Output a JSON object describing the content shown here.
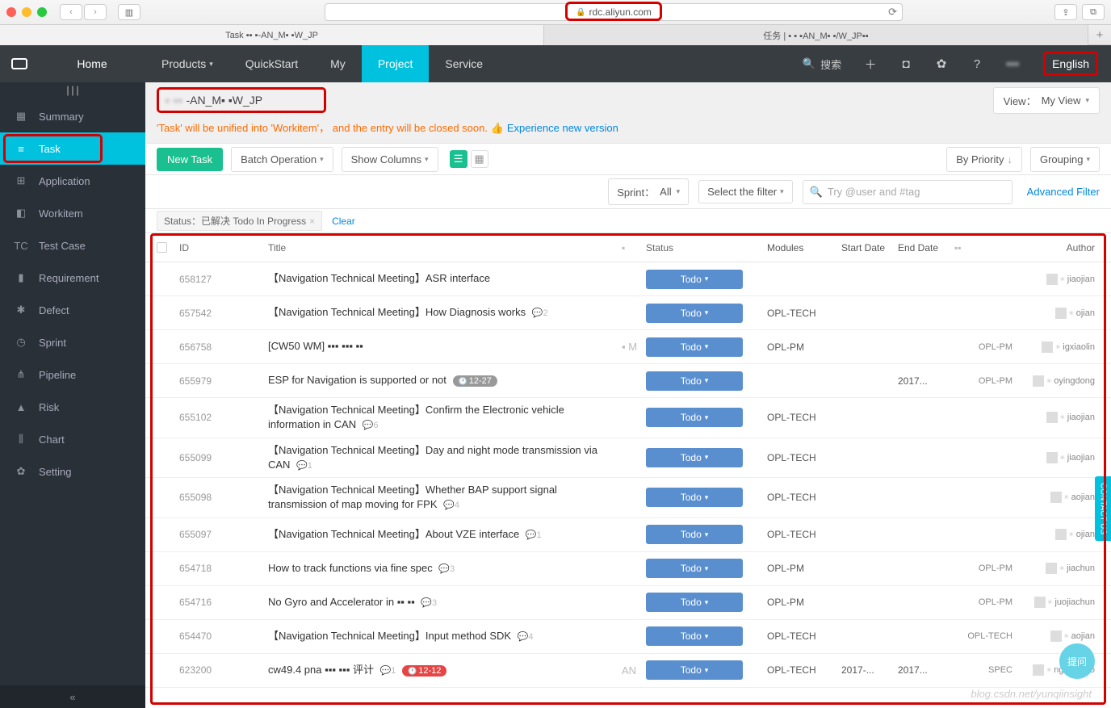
{
  "browser": {
    "url_host": "rdc.aliyun.com",
    "tabs": [
      "Task ▪▪ ▪-AN_M▪ ▪W_JP",
      "任务 | ▪ ▪ ▪AN_M▪ ▪/W_JP▪▪"
    ]
  },
  "topnav": {
    "home": "Home",
    "products": "Products",
    "quickstart": "QuickStart",
    "my": "My",
    "project": "Project",
    "service": "Service",
    "search_label": "搜索",
    "language": "English"
  },
  "sidebar": {
    "items": [
      {
        "icon": "▦",
        "label": "Summary"
      },
      {
        "icon": "≡",
        "label": "Task"
      },
      {
        "icon": "⊞",
        "label": "Application"
      },
      {
        "icon": "◧",
        "label": "Workitem"
      },
      {
        "icon": "TC",
        "label": "Test Case"
      },
      {
        "icon": "▮",
        "label": "Requirement"
      },
      {
        "icon": "✱",
        "label": "Defect"
      },
      {
        "icon": "◷",
        "label": "Sprint"
      },
      {
        "icon": "⋔",
        "label": "Pipeline"
      },
      {
        "icon": "▲",
        "label": "Risk"
      },
      {
        "icon": "⫼",
        "label": "Chart"
      },
      {
        "icon": "✿",
        "label": "Setting"
      }
    ]
  },
  "project": {
    "name_visible": "-AN_M▪ ▪W_JP",
    "view_label": "View：",
    "view_value": "My View"
  },
  "notice": {
    "warn": "'Task' will be unified into 'Workitem'， and the entry will be closed soon.",
    "link": "Experience new version"
  },
  "toolbar": {
    "new_task": "New Task",
    "batch_op": "Batch Operation",
    "show_cols": "Show Columns",
    "by_priority": "By Priority",
    "grouping": "Grouping"
  },
  "filter": {
    "sprint_label": "Sprint：",
    "sprint_value": "All",
    "select_filter": "Select the filter",
    "search_placeholder": "Try @user and #tag",
    "advanced": "Advanced Filter"
  },
  "status_chip": {
    "text": "Status：已解决  Todo  In Progress",
    "clear": "Clear"
  },
  "columns": {
    "id": "ID",
    "title": "Title",
    "status": "Status",
    "modules": "Modules",
    "start": "Start Date",
    "end": "End Date",
    "x": "▪▪",
    "author": "Author"
  },
  "rows": [
    {
      "id": "658127",
      "title": "【Navigation Technical Meeting】ASR interface",
      "comments": "",
      "badge": "",
      "badge_red": false,
      "status": "Todo",
      "modules": "",
      "start": "",
      "end": "",
      "x": "",
      "author": "jiaojian"
    },
    {
      "id": "657542",
      "title": "【Navigation Technical Meeting】How Diagnosis works",
      "comments": "2",
      "badge": "",
      "badge_red": false,
      "status": "Todo",
      "modules": "OPL-TECH",
      "start": "",
      "end": "",
      "x": "",
      "author": "ojian"
    },
    {
      "id": "656758",
      "title": "[CW50 WM] ▪▪▪ ▪▪▪ ▪▪",
      "comments": "",
      "badge": "",
      "badge_red": false,
      "titleicon": "▪ M",
      "status": "Todo",
      "modules": "OPL-PM",
      "start": "",
      "end": "",
      "x": "OPL-PM",
      "author": "igxiaolin"
    },
    {
      "id": "655979",
      "title": "ESP for Navigation is supported or not",
      "comments": "",
      "badge": "12-27",
      "badge_red": false,
      "status": "Todo",
      "modules": "",
      "start": "",
      "end": "2017...",
      "x": "OPL-PM",
      "author": "oyingdong"
    },
    {
      "id": "655102",
      "title": "【Navigation Technical Meeting】Confirm the Electronic vehicle information in CAN",
      "comments": "6",
      "badge": "",
      "badge_red": false,
      "status": "Todo",
      "modules": "OPL-TECH",
      "start": "",
      "end": "",
      "x": "",
      "author": "jiaojian"
    },
    {
      "id": "655099",
      "title": "【Navigation Technical Meeting】Day and night mode transmission via CAN",
      "comments": "1",
      "badge": "",
      "badge_red": false,
      "status": "Todo",
      "modules": "OPL-TECH",
      "start": "",
      "end": "",
      "x": "",
      "author": "jiaojian"
    },
    {
      "id": "655098",
      "title": "【Navigation Technical Meeting】Whether BAP support signal transmission of map moving for FPK",
      "comments": "4",
      "badge": "",
      "badge_red": false,
      "status": "Todo",
      "modules": "OPL-TECH",
      "start": "",
      "end": "",
      "x": "",
      "author": "aojian"
    },
    {
      "id": "655097",
      "title": "【Navigation Technical Meeting】About VZE interface",
      "comments": "1",
      "badge": "",
      "badge_red": false,
      "status": "Todo",
      "modules": "OPL-TECH",
      "start": "",
      "end": "",
      "x": "",
      "author": "ojian"
    },
    {
      "id": "654718",
      "title": "How to track functions via fine spec",
      "comments": "3",
      "badge": "",
      "badge_red": false,
      "status": "Todo",
      "modules": "OPL-PM",
      "start": "",
      "end": "",
      "x": "OPL-PM",
      "author": "jiachun"
    },
    {
      "id": "654716",
      "title": "No Gyro and Accelerator in ▪▪ ▪▪",
      "comments": "3",
      "badge": "",
      "badge_red": false,
      "status": "Todo",
      "modules": "OPL-PM",
      "start": "",
      "end": "",
      "x": "OPL-PM",
      "author": "juojiachun"
    },
    {
      "id": "654470",
      "title": "【Navigation Technical Meeting】Input method SDK",
      "comments": "4",
      "badge": "",
      "badge_red": false,
      "status": "Todo",
      "modules": "OPL-TECH",
      "start": "",
      "end": "",
      "x": "OPL-TECH",
      "author": "aojian"
    },
    {
      "id": "623200",
      "title": "cw49.4 pna ▪▪▪ ▪▪▪ 评计",
      "comments": "1",
      "badge": "12-12",
      "badge_red": true,
      "titleicon": "AN",
      "status": "Todo",
      "modules": "OPL-TECH",
      "start": "2017-...",
      "end": "2017...",
      "x": "SPEC",
      "author": "nghaichao"
    }
  ],
  "contact_label": "CONTACT US",
  "ask_label": "提问",
  "watermark": "blog.csdn.net/yunqiinsight"
}
